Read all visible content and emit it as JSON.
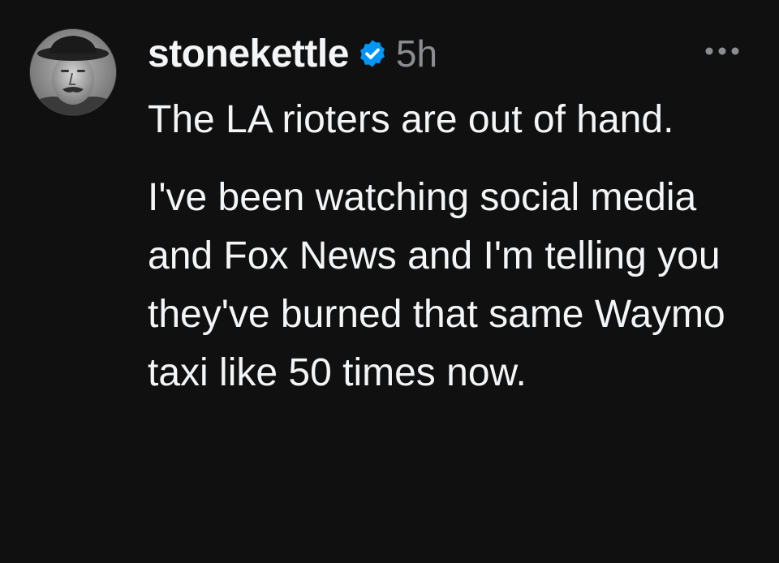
{
  "post": {
    "username": "stonekettle",
    "verified": true,
    "timestamp": "5h",
    "paragraphs": [
      "The LA rioters are out of hand.",
      "I've been watching social media and Fox News and I'm telling you they've burned that same Waymo taxi like 50 times now."
    ],
    "more_icon": "more-horizontal-icon",
    "verified_icon": "verified-badge-icon",
    "colors": {
      "background": "#101010",
      "text": "#f3f5f7",
      "muted": "#8b8d90",
      "verified": "#0095f6"
    }
  }
}
